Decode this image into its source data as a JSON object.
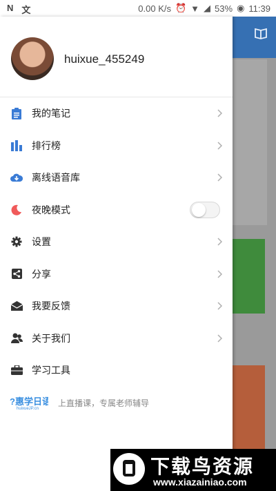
{
  "status_bar": {
    "left_icons": [
      "N",
      "文"
    ],
    "net_speed": "0.00 K/s",
    "battery": "53%",
    "time": "11:39"
  },
  "profile": {
    "username": "huixue_455249"
  },
  "menu": [
    {
      "label": "我的笔记",
      "icon": "note-icon",
      "color": "#3a7bd5",
      "has_arrow": true
    },
    {
      "label": "排行榜",
      "icon": "bar-chart-icon",
      "color": "#3a7bd5",
      "has_arrow": true
    },
    {
      "label": "离线语音库",
      "icon": "cloud-download-icon",
      "color": "#3a7bd5",
      "has_arrow": true
    },
    {
      "label": "夜晚模式",
      "icon": "moon-icon",
      "color": "#f05a5a",
      "toggle": false
    },
    {
      "label": "设置",
      "icon": "gear-icon",
      "color": "#333333",
      "has_arrow": true
    },
    {
      "label": "分享",
      "icon": "share-icon",
      "color": "#333333",
      "has_arrow": true
    },
    {
      "label": "我要反馈",
      "icon": "mail-icon",
      "color": "#333333",
      "has_arrow": true
    },
    {
      "label": "关于我们",
      "icon": "users-icon",
      "color": "#333333",
      "has_arrow": true
    },
    {
      "label": "学习工具",
      "icon": "briefcase-icon",
      "color": "#333333",
      "has_arrow": false
    }
  ],
  "footer": {
    "logo_text": "惠学日语",
    "logo_sub": "huixueJP.cn",
    "slogan": "上直播课，专属老师辅导"
  },
  "watermark": {
    "title": "下载鸟资源",
    "url": "www.xiazainiao.com"
  },
  "colors": {
    "accent": "#3a7bd5",
    "header_blue": "#3670b3"
  }
}
